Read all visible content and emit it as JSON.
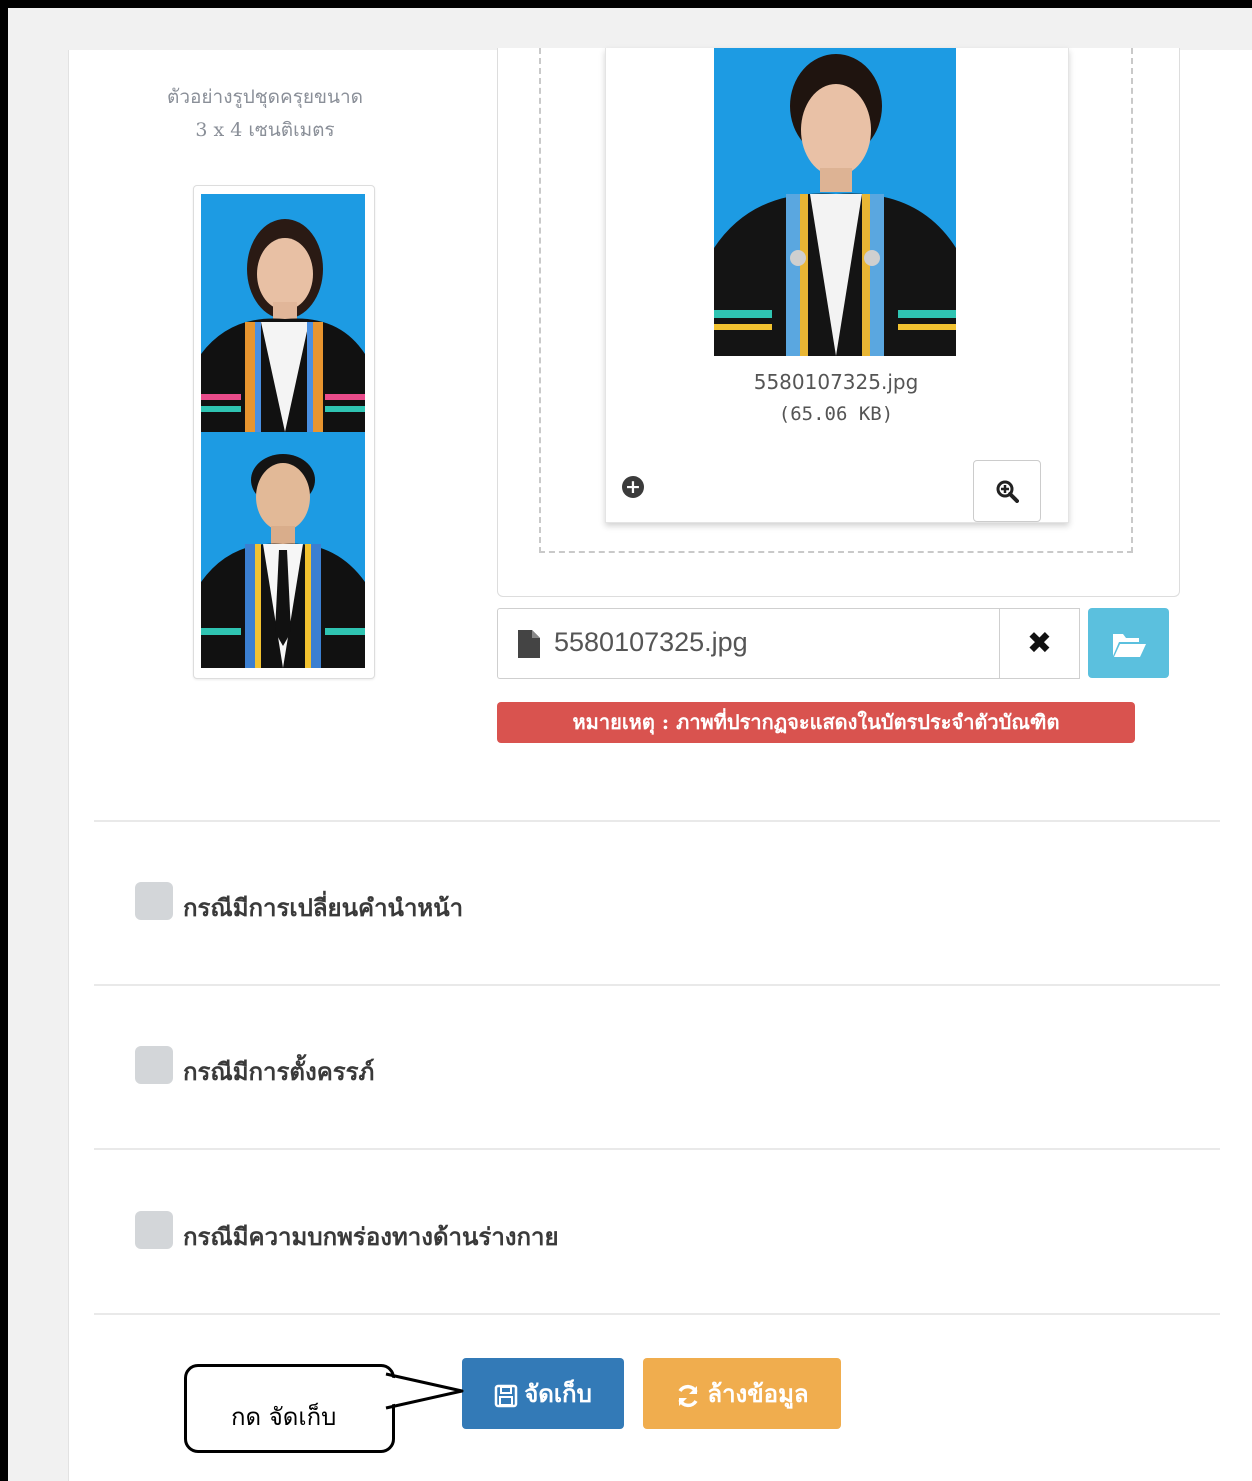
{
  "sample": {
    "caption_line1": "ตัวอย่างรูปชุดครุยขนาด",
    "caption_line2": "3 x 4 เซนติเมตร"
  },
  "preview": {
    "file_name": "5580107325.jpg",
    "file_size": "(65.06 KB)"
  },
  "file_input": {
    "value": "5580107325.jpg",
    "remove_label": "✖"
  },
  "note": "หมายเหตุ : ภาพที่ปรากฏจะแสดงในบัตรประจำตัวบัณฑิต",
  "options": [
    {
      "label": "กรณีมีการเปลี่ยนคำนำหน้า",
      "checked": false
    },
    {
      "label": "กรณีมีการตั้งครรภ์",
      "checked": false
    },
    {
      "label": "กรณีมีความบกพร่องทางด้านร่างกาย",
      "checked": false
    }
  ],
  "actions": {
    "save_label": "จัดเก็บ",
    "clear_label": "ล้างข้อมูล"
  },
  "callout": {
    "text": "กด  จัดเก็บ"
  },
  "colors": {
    "save": "#337ab7",
    "clear": "#f0ad4e",
    "browse": "#5bc0de",
    "note": "#d9534f",
    "photo_bg": "#1d9be3"
  }
}
